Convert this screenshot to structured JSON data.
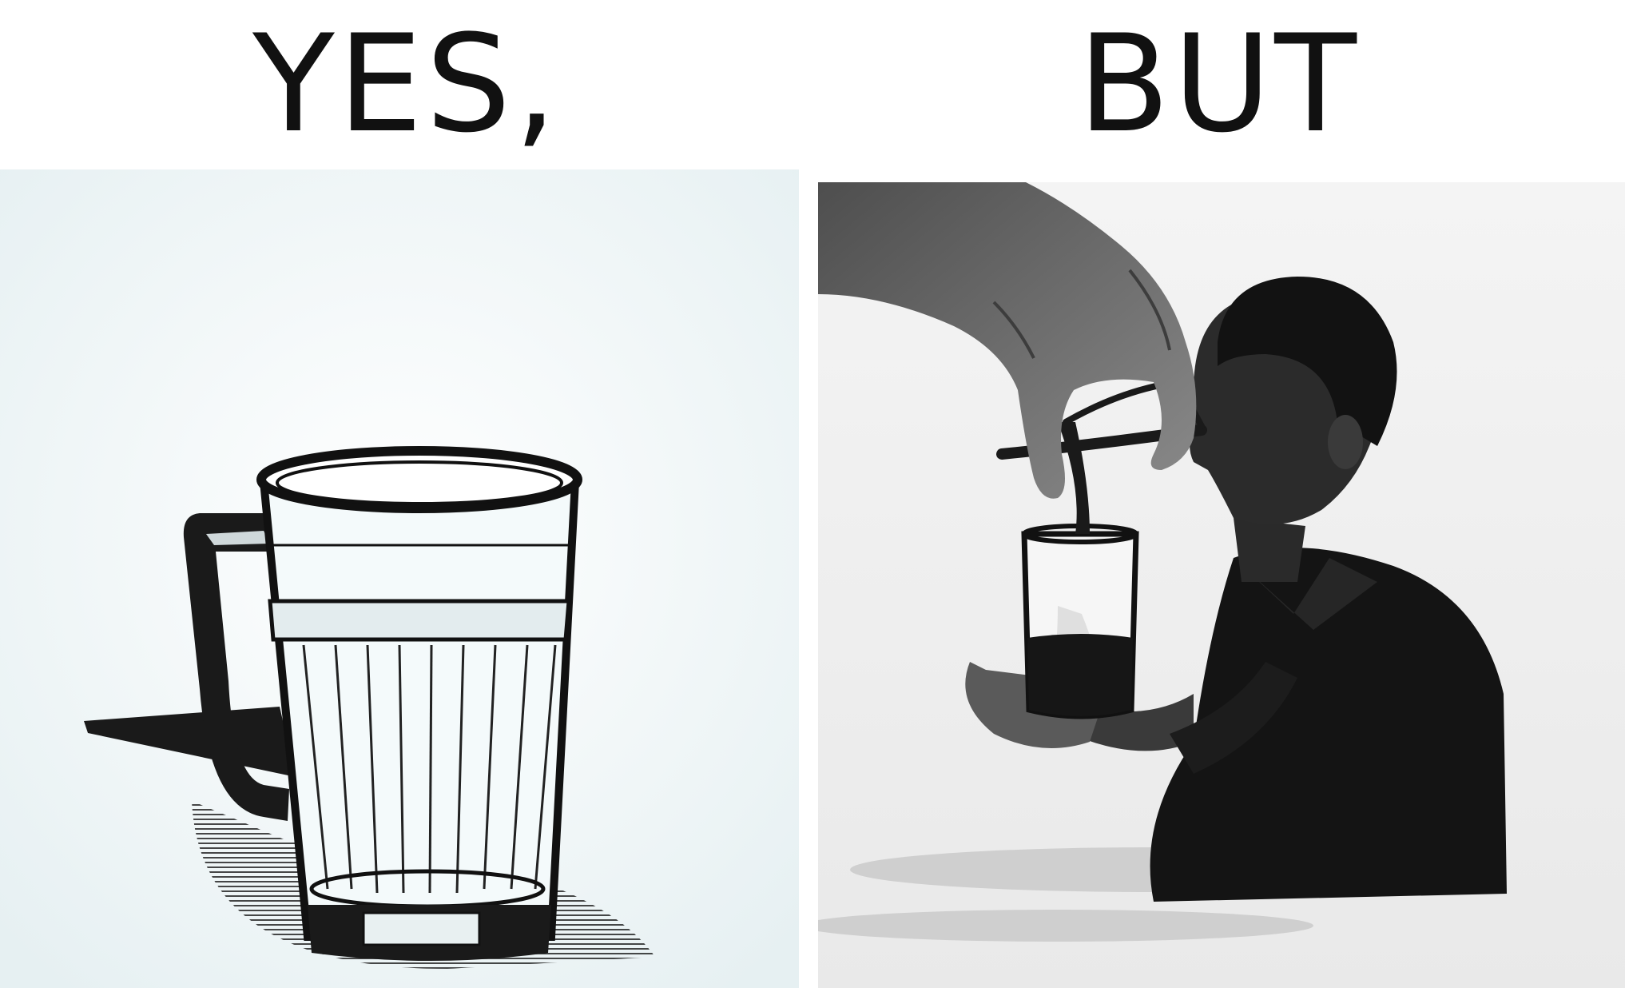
{
  "captions": {
    "left": "YES,",
    "right": "BUT"
  },
  "colors": {
    "ink": "#111111",
    "left_background": "#eef5f6",
    "right_background": "#f1f1f1",
    "hand": "#6e6e6e",
    "silhouette": "#161616"
  },
  "panels": {
    "left": {
      "subject": "large-mug-icon"
    },
    "right": {
      "subject": "person-drinking-illustration"
    }
  }
}
